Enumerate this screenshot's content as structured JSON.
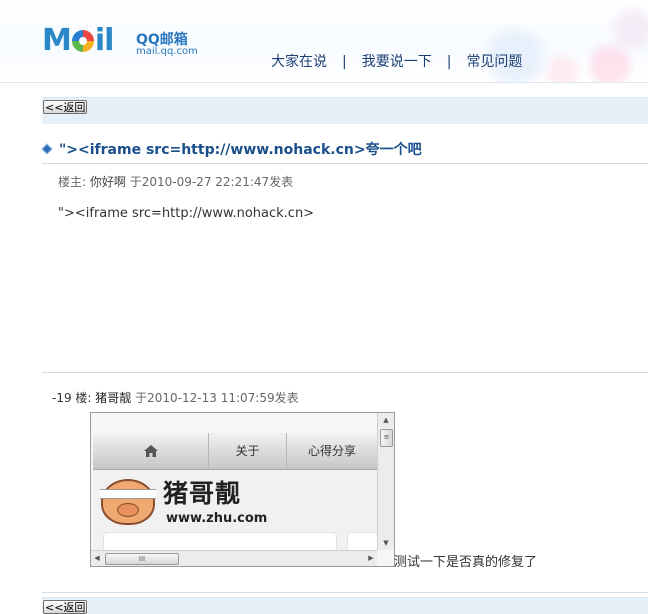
{
  "header": {
    "logo_word": "MOIL",
    "brand": "QQ邮箱",
    "domain": "mail.qq.com",
    "nav": [
      "大家在说",
      "我要说一下",
      "常见问题"
    ]
  },
  "back_label": "<<返回",
  "post": {
    "title": "\"><iframe src=http://www.nohack.cn>夸一个吧",
    "author_prefix": "楼主:",
    "author": "你好啊",
    "date": "于2010-09-27 22:21:47发表",
    "body": "\"><iframe src=http://www.nohack.cn>"
  },
  "reply": {
    "floor": "-19 楼:",
    "author": "猪哥靓",
    "date": "于2010-12-13 11:07:59发表",
    "embedded_site": {
      "nav": [
        "关于",
        "心得分享"
      ],
      "title": "猪哥靓",
      "url": "www.zhu.com",
      "hscroll_grip": "III"
    },
    "caption": "测试一下是否真的修复了"
  },
  "colors": {
    "accent": "#1a4f8b",
    "bar": "#e5f0f8"
  }
}
